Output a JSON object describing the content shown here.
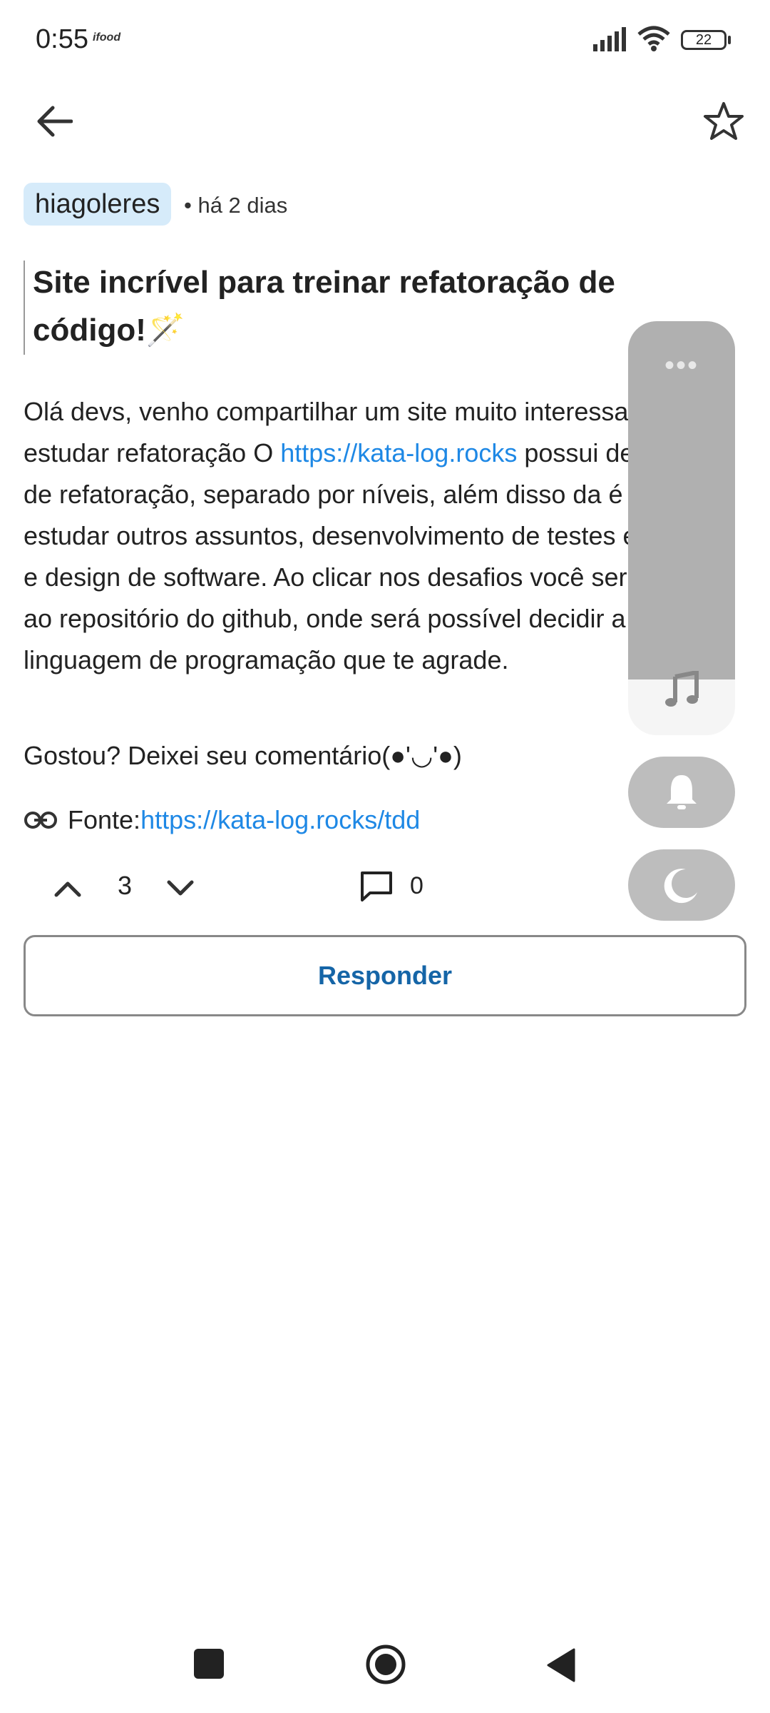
{
  "status_bar": {
    "time": "0:55",
    "app_badge": "ifood",
    "battery": "22"
  },
  "header": {
    "back_icon": "arrow-left-icon",
    "favorite_icon": "star-outline-icon"
  },
  "post": {
    "author": "hiagoleres",
    "time": "• há 2 dias",
    "title": "Site incrível para treinar refatoração de código!🪄",
    "body_1": "Olá devs, venho compartilhar um site muito interessante para estudar refatoração O ",
    "body_link": "https://kata-log.rocks",
    "body_2": " possui desafios de refatoração, separado por níveis, além disso da é possível estudar outros assuntos, desenvolvimento de testes em TDD e design de software. Ao clicar nos desafios você será levado ao repositório do github, onde será possível decidir a linguagem de programação que te agrade.",
    "gostou": "Gostou? Deixei seu comentário(●'◡'●)",
    "fonte_label": "Fonte: ",
    "fonte_link": "https://kata-log.rocks/tdd"
  },
  "actions": {
    "votes": "3",
    "comments": "0",
    "reply_label": "Responder"
  },
  "floating": {
    "dots": "•••",
    "icons": [
      "music-note-icon",
      "bell-icon",
      "moon-icon"
    ]
  },
  "colors": {
    "link": "#1e88e5",
    "chip": "#d6ebfa",
    "reply_text": "#1565a7"
  }
}
